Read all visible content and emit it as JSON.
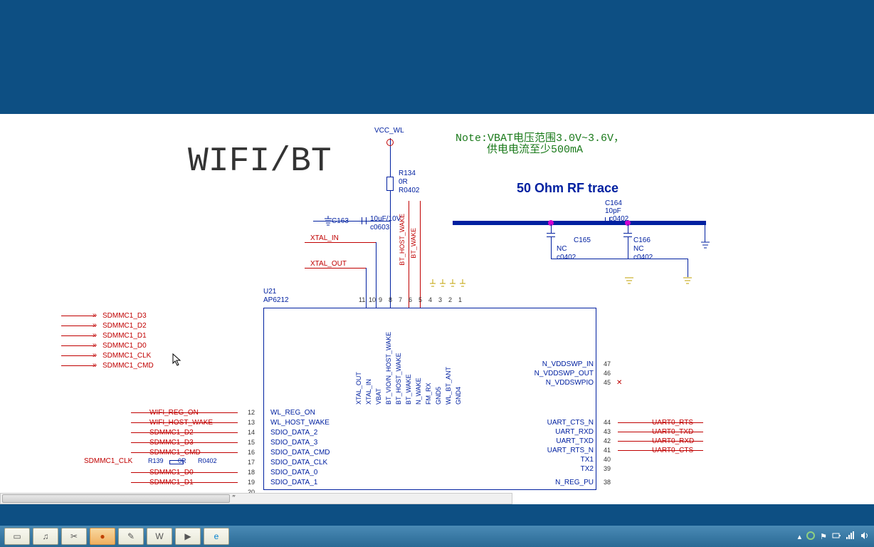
{
  "title_main": "WIFI/BT",
  "note_line1": "Note:VBAT电压范围3.0V~3.6V，",
  "note_line2": "供电电流至少500mA",
  "rf_trace_label": "50 Ohm RF trace",
  "power_rail": "VCC_WL",
  "chip": {
    "refdes": "U21",
    "part": "AP6212"
  },
  "resistors": {
    "r134": {
      "ref": "R134",
      "value": "0R",
      "footprint": "R0402"
    },
    "r139": {
      "ref": "R139",
      "value": "0R",
      "footprint": "R0402"
    }
  },
  "capacitors": {
    "c163": {
      "ref": "C163",
      "value": "10uF/10V",
      "footprint": "c0603"
    },
    "c164": {
      "ref": "C164",
      "value": "10pF",
      "footprint": "c0402"
    },
    "c165": {
      "ref": "C165",
      "value": "NC",
      "footprint": "c0402"
    },
    "c166": {
      "ref": "C166",
      "value": "NC",
      "footprint": "c0402"
    }
  },
  "xtal_nets": {
    "in": "XTAL_IN",
    "out": "XTAL_OUT"
  },
  "sd_bus": [
    "SDMMC1_D3",
    "SDMMC1_D2",
    "SDMMC1_D1",
    "SDMMC1_D0",
    "SDMMC1_CLK",
    "SDMMC1_CMD"
  ],
  "left_nets": [
    {
      "label": "WIFI_REG_ON",
      "pin": "12"
    },
    {
      "label": "WIFI_HOST_WAKE",
      "pin": "13"
    },
    {
      "label": "SDMMC1_D2",
      "pin": "14"
    },
    {
      "label": "SDMMC1_D3",
      "pin": "15"
    },
    {
      "label": "SDMMC1_CMD",
      "pin": "16"
    },
    {
      "label": "SDMMC1_CLK",
      "pin": "17"
    },
    {
      "label": "SDMMC1_D0",
      "pin": "18"
    },
    {
      "label": "SDMMC1_D1",
      "pin": "19"
    }
  ],
  "left_pin_labels": [
    "WL_REG_ON",
    "WL_HOST_WAKE",
    "SDIO_DATA_2",
    "SDIO_DATA_3",
    "SDIO_DATA_CMD",
    "SDIO_DATA_CLK",
    "SDIO_DATA_0",
    "SDIO_DATA_1"
  ],
  "top_pins": [
    {
      "num": "11",
      "label": "XTAL_OUT"
    },
    {
      "num": "10",
      "label": "XTAL_IN"
    },
    {
      "num": "9",
      "label": "VBAT"
    },
    {
      "num": "8",
      "label": "BT_VIO/N_HOST_WAKE"
    },
    {
      "num": "7",
      "label": "BT_HOST_WAKE"
    },
    {
      "num": "6",
      "label": "BT_WAKE"
    },
    {
      "num": "5",
      "label": "N_WAKE"
    },
    {
      "num": "4",
      "label": "FM_RX"
    },
    {
      "num": "3",
      "label": "GND5"
    },
    {
      "num": "2",
      "label": "WL_BT_ANT"
    },
    {
      "num": "1",
      "label": "GND4"
    }
  ],
  "right_top_labels": [
    {
      "label": "N_VDDSWP_IN",
      "pin": "47"
    },
    {
      "label": "N_VDDSWP_OUT",
      "pin": "46"
    },
    {
      "label": "N_VDDSWPIO",
      "pin": "45"
    }
  ],
  "right_mid_labels_left": [
    {
      "label": "UART_CTS_N",
      "pin": "44"
    },
    {
      "label": "UART_RXD",
      "pin": "43"
    },
    {
      "label": "UART_TXD",
      "pin": "42"
    },
    {
      "label": "UART_RTS_N",
      "pin": "41"
    },
    {
      "label": "TX1",
      "pin": "40"
    },
    {
      "label": "TX2",
      "pin": "39"
    }
  ],
  "right_mid_labels_far": [
    "UART0_RTS",
    "UART0_TXD",
    "UART0_RXD",
    "UART0_CTS"
  ],
  "right_bottom_label": {
    "label": "N_REG_PU",
    "pin": "38"
  },
  "bt_vert": {
    "host_wake": "BT_HOST_WAKE",
    "wake": "BT_WAKE"
  },
  "taskbar_icons": [
    "desktop-icon",
    "music-icon",
    "clip-icon",
    "orange-icon",
    "note-icon",
    "w-icon",
    "video-icon",
    "ie-icon"
  ],
  "tray_icons": [
    "chevron-up-icon",
    "network-icon",
    "flag-icon",
    "power-icon",
    "signal-icon",
    "volume-icon"
  ]
}
